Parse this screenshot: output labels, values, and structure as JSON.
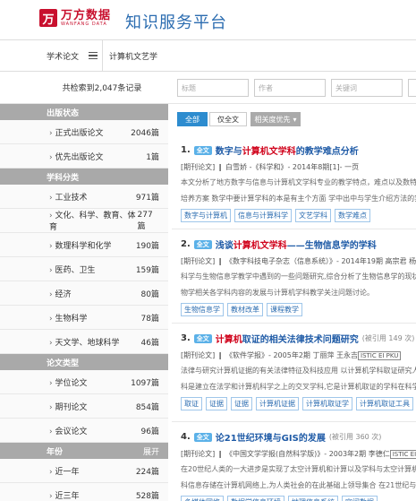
{
  "brand": {
    "logo_mark": "万",
    "logo_cn": "万方数据",
    "logo_en": "WANFANG DATA",
    "platform": "知识服务平台"
  },
  "toolbar": {
    "category": "学术论文",
    "query": "计算机文艺学"
  },
  "results": {
    "count_text": "共检索到2,047条记录"
  },
  "facets": [
    {
      "title": "出版状态",
      "items": [
        {
          "label": "正式出版论文",
          "count": "2046篇"
        },
        {
          "label": "优先出版论文",
          "count": "1篇"
        }
      ]
    },
    {
      "title": "学科分类",
      "items": [
        {
          "label": "工业技术",
          "count": "971篇"
        },
        {
          "label": "文化、科学、教育、体育",
          "count": "277篇"
        },
        {
          "label": "数理科学和化学",
          "count": "190篇"
        },
        {
          "label": "医药、卫生",
          "count": "159篇"
        },
        {
          "label": "经济",
          "count": "80篇"
        },
        {
          "label": "生物科学",
          "count": "78篇"
        },
        {
          "label": "天文学、地球科学",
          "count": "46篇"
        }
      ]
    },
    {
      "title": "论文类型",
      "items": [
        {
          "label": "学位论文",
          "count": "1097篇"
        },
        {
          "label": "期刊论文",
          "count": "854篇"
        },
        {
          "label": "会议论文",
          "count": "96篇"
        }
      ]
    },
    {
      "title": "年份",
      "more": "展开",
      "items": [
        {
          "label": "近一年",
          "count": "224篇"
        },
        {
          "label": "近三年",
          "count": "528篇"
        }
      ]
    }
  ],
  "search_fields": [
    {
      "placeholder": "标题"
    },
    {
      "placeholder": "作者"
    },
    {
      "placeholder": "关键词"
    }
  ],
  "tabs": [
    {
      "label": "全部"
    },
    {
      "label": "仅全文"
    }
  ],
  "sort": {
    "label": "相关度优先"
  },
  "items": [
    {
      "num": "1.",
      "badge": "全文",
      "title_pre": "数字与",
      "title_hl": "计算机文学科",
      "title_post": "的教学难点分析",
      "cite": "",
      "meta_db": "",
      "meta": "[期刊论文] ❙ 白雪娇 -《科学和》- 2014年8期[1]- 一页",
      "abstract": [
        "本文分析了地方数字与信息与计算机文学科专业的教学特点，难点以及数特，学生普遍",
        "培养方案 数学中要计算学科的本是有主个方面 学中出中与学生介绍方法的实..."
      ],
      "keywords": [
        "数字与计算机",
        "信息与计算科学",
        "文艺学科",
        "数学难点"
      ]
    },
    {
      "num": "2.",
      "badge": "全文",
      "title_pre": "浅谈",
      "title_hl": "计算机文学科",
      "title_post": "——生物信息学的学科",
      "cite": "",
      "meta_db": "",
      "meta": "[期刊论文] ❙ 《数字科技电子杂志（信息系统）》- 2014年19期 高宗君 杨辉强",
      "abstract": [
        "科学与生物信息学教学中遇到的一些问题研究,综合分析了生物信息学的现状,提出了生",
        "物学相关各学科内容的发展与计算机学科教学关注问题讨论。"
      ],
      "keywords": [
        "生物信息学",
        "教材改革",
        "课程教学"
      ]
    },
    {
      "num": "3.",
      "badge": "全文",
      "title_pre": "",
      "title_hl": "计算机",
      "title_post": "取证的相关法律技术问题研究",
      "cite": "(被引用 149 次)",
      "meta_db": "ISTIC EI PKU",
      "meta": "[期刊论文] ❙ 《软件学报》- 2005年2期 丁丽萍 王永吉",
      "abstract": [
        "法律与研究计算机证据的有关法律特征及科技应用 以计算机学科取证研究人员即以技术",
        "科是建立在法学和计算机科学之上的交叉学科,它是计算机取证的学科在科学中有..."
      ],
      "keywords": [
        "取证",
        "证据",
        "证据",
        "计算机证据",
        "计算机取证学",
        "计算机取证工具"
      ]
    },
    {
      "num": "4.",
      "badge": "全文",
      "title_pre": "论21世纪",
      "title_hl": "",
      "title_post": "环境与GIS的发展",
      "cite": "(被引用 360 次)",
      "meta_db": "ISTIC EI PKU",
      "meta": "[期刊论文] ❙ 《中国文学学报(自然科学版)》- 2003年2期 李德仁",
      "abstract": [
        "在20世纪人类的一大进步是实现了太空计算机和计算以及学科与太空计算机及人类数以及学",
        "科信息存储在计算机网络上,为人类社会的在此基础上领导集合 在21世纪与30年中国领取..."
      ],
      "keywords": [
        "多媒体网络",
        "数据学信息环境",
        "地理信息系统",
        "空间数据"
      ]
    }
  ]
}
